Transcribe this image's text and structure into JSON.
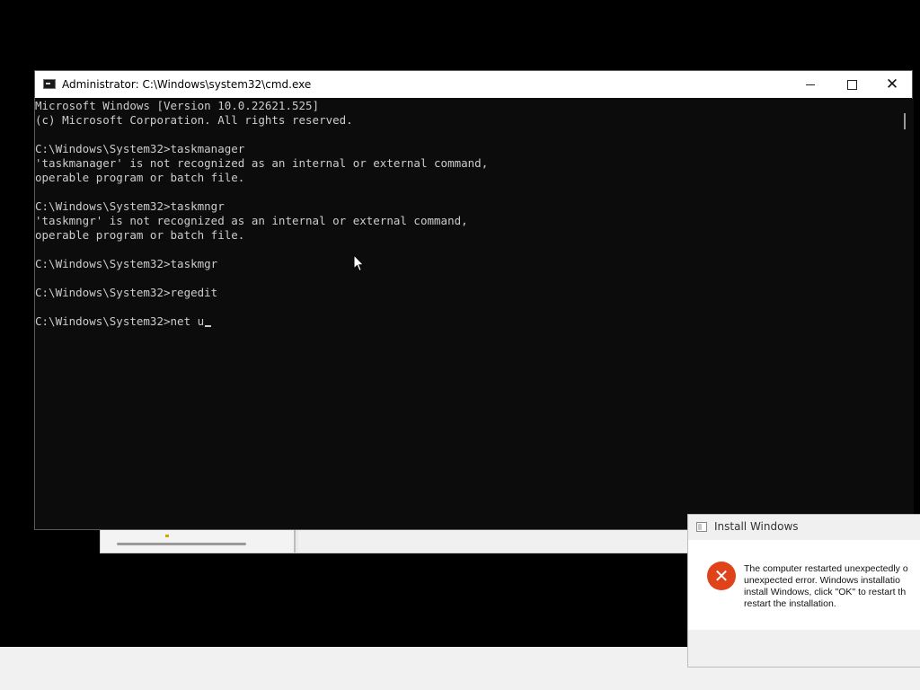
{
  "cmd_window": {
    "title": "Administrator: C:\\Windows\\system32\\cmd.exe",
    "controls": {
      "minimize": "",
      "maximize": "",
      "close": "✕"
    },
    "console_lines": [
      "Microsoft Windows [Version 10.0.22621.525]",
      "(c) Microsoft Corporation. All rights reserved.",
      "",
      "C:\\Windows\\System32>taskmanager",
      "'taskmanager' is not recognized as an internal or external command,",
      "operable program or batch file.",
      "",
      "C:\\Windows\\System32>taskmngr",
      "'taskmngr' is not recognized as an internal or external command,",
      "operable program or batch file.",
      "",
      "C:\\Windows\\System32>taskmgr",
      "",
      "C:\\Windows\\System32>regedit",
      "",
      "C:\\Windows\\System32>net u"
    ],
    "colors": {
      "background": "#0c0c0c",
      "text": "#cccccc"
    }
  },
  "install_dialog": {
    "title": "Install Windows",
    "message_lines": [
      "The computer restarted unexpectedly o",
      "unexpected error. Windows installatio",
      "install Windows, click \"OK\" to restart th",
      "restart the installation."
    ],
    "icon": "error-icon",
    "icon_color": "#e0421a"
  }
}
